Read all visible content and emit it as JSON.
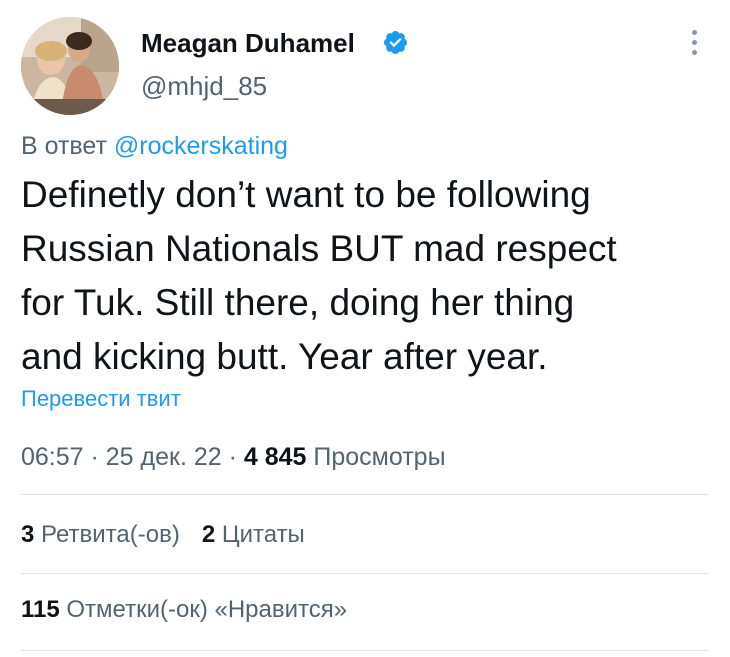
{
  "author": {
    "name": "Meagan Duhamel",
    "handle": "@mhjd_85"
  },
  "reply": {
    "prefix": "В ответ",
    "mention": "@rockerskating"
  },
  "tweet": {
    "lines": [
      "Definetly don’t want to be following",
      "Russian Nationals BUT mad respect",
      "for Tuk. Still there, doing her thing",
      "and kicking butt. Year after year."
    ],
    "translate_label": "Перевести твит"
  },
  "meta": {
    "time": "06:57",
    "sep1": " · ",
    "date": "25 дек. 22",
    "sep2": " · ",
    "views_count": "4 845",
    "views_label": "Просмотры"
  },
  "stats": {
    "retweets_count": "3",
    "retweets_label": "Ретвита(-ов)",
    "quotes_count": "2",
    "quotes_label": "Цитаты",
    "likes_count": "115",
    "likes_label": "Отметки(-ок) «Нравится»"
  },
  "icons": {
    "verified": "verified-badge-icon",
    "more": "more-options-icon"
  },
  "colors": {
    "accent": "#1d9bf0",
    "text": "#0f1419",
    "secondary": "#536471",
    "divider": "#dfe3e7"
  }
}
